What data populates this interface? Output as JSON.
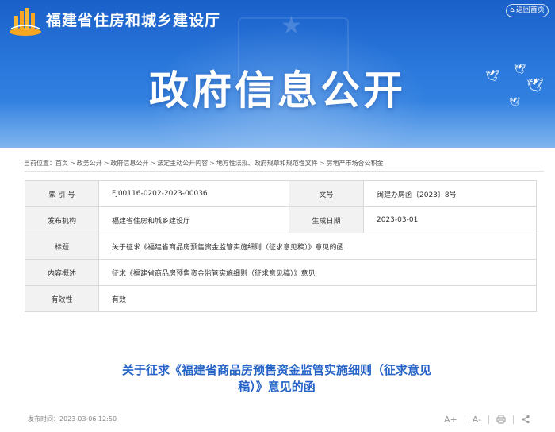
{
  "header": {
    "site_title": "福建省住房和城乡建设厅",
    "home_label": "返回首页",
    "banner_title": "政府信息公开"
  },
  "breadcrumb": {
    "prefix": "当前位置：",
    "items": [
      "首页",
      "政务公开",
      "政府信息公开",
      "法定主动公开内容",
      "地方性法规、政府规章和规范性文件",
      "房地产市场合公积金"
    ],
    "separator": ">"
  },
  "info_table": {
    "index_label": "索 引 号",
    "index_value": "FJ00116-0202-2023-00036",
    "doc_no_label": "文号",
    "doc_no_value": "闽建办房函〔2023〕8号",
    "publisher_label": "发布机构",
    "publisher_value": "福建省住房和城乡建设厅",
    "date_label": "生成日期",
    "date_value": "2023-03-01",
    "title_label": "标题",
    "title_value": "关于征求《福建省商品房预售资金监管实施细则（征求意见稿）》意见的函",
    "summary_label": "内容概述",
    "summary_value": "征求《福建省商品房预售资金监管实施细则（征求意见稿）》意见",
    "validity_label": "有效性",
    "validity_value": "有效"
  },
  "article": {
    "title_line1": "关于征求《福建省商品房预售资金监管实施细则（征求意见",
    "title_line2": "稿）》意见的函",
    "publish_time": "发布时间：2023-03-06 12:50"
  },
  "tools": {
    "font_larger": "A+",
    "font_smaller": "A-",
    "print_icon": "print-icon",
    "share_icon": "share-icon"
  },
  "colors": {
    "banner_blue": "#2a78dc",
    "title_blue": "#2563c7",
    "label_bg": "#f2f2f2"
  }
}
